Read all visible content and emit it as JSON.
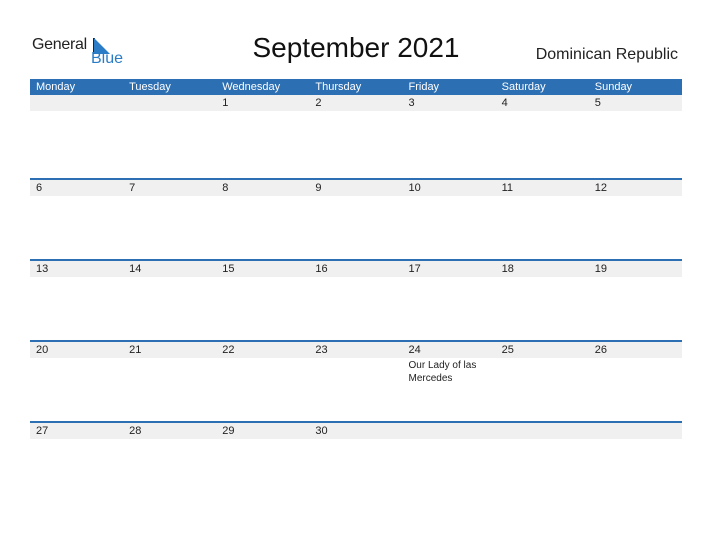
{
  "logo": {
    "general": "General",
    "blue": "Blue"
  },
  "title": "September 2021",
  "country": "Dominican Republic",
  "colors": {
    "accent": "#2d6fb3",
    "band": "#f0f0f0"
  },
  "weekdays": [
    "Monday",
    "Tuesday",
    "Wednesday",
    "Thursday",
    "Friday",
    "Saturday",
    "Sunday"
  ],
  "weeks": [
    [
      {
        "day": ""
      },
      {
        "day": ""
      },
      {
        "day": "1"
      },
      {
        "day": "2"
      },
      {
        "day": "3"
      },
      {
        "day": "4"
      },
      {
        "day": "5"
      }
    ],
    [
      {
        "day": "6"
      },
      {
        "day": "7"
      },
      {
        "day": "8"
      },
      {
        "day": "9"
      },
      {
        "day": "10"
      },
      {
        "day": "11"
      },
      {
        "day": "12"
      }
    ],
    [
      {
        "day": "13"
      },
      {
        "day": "14"
      },
      {
        "day": "15"
      },
      {
        "day": "16"
      },
      {
        "day": "17"
      },
      {
        "day": "18"
      },
      {
        "day": "19"
      }
    ],
    [
      {
        "day": "20"
      },
      {
        "day": "21"
      },
      {
        "day": "22"
      },
      {
        "day": "23"
      },
      {
        "day": "24",
        "event": "Our Lady of las Mercedes"
      },
      {
        "day": "25"
      },
      {
        "day": "26"
      }
    ],
    [
      {
        "day": "27"
      },
      {
        "day": "28"
      },
      {
        "day": "29"
      },
      {
        "day": "30"
      },
      {
        "day": ""
      },
      {
        "day": ""
      },
      {
        "day": ""
      }
    ]
  ]
}
